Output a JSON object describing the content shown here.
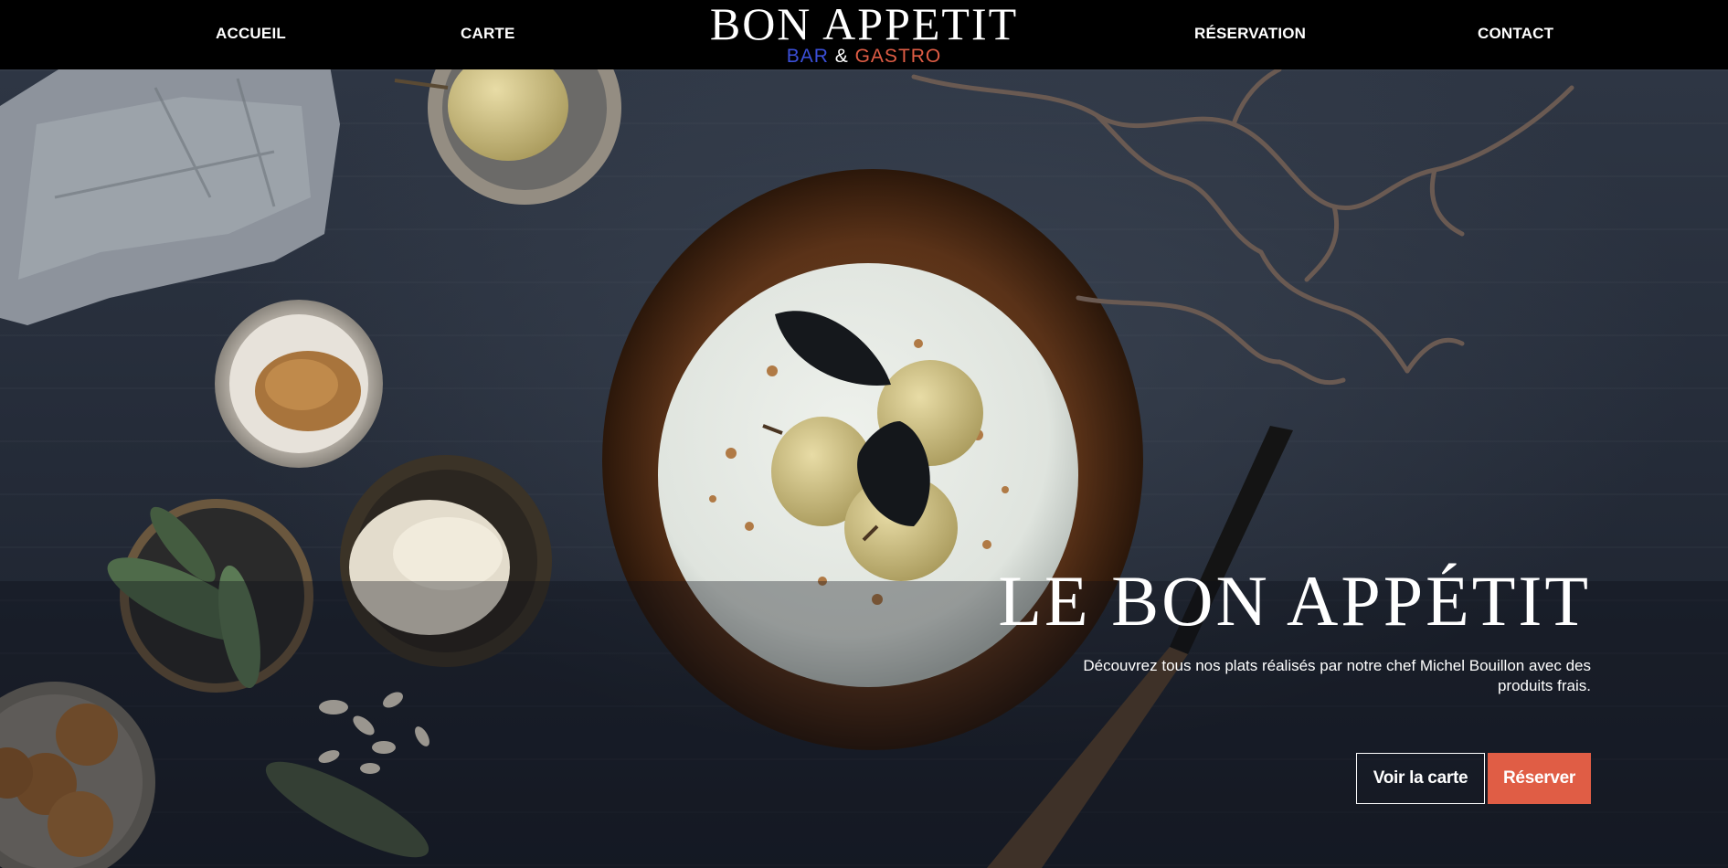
{
  "header": {
    "nav_left": [
      "ACCUEIL",
      "CARTE"
    ],
    "nav_right": [
      "RÉSERVATION",
      "CONTACT"
    ],
    "logo": {
      "title": "BON APPETIT",
      "sub_bar": "BAR",
      "sub_amp": "&",
      "sub_gastro": "GASTRO"
    }
  },
  "hero": {
    "title": "LE BON APPÉTIT",
    "description": "Découvrez tous nos plats réalisés par notre chef Michel Bouillon avec des produits frais.",
    "btn_menu": "Voir la carte",
    "btn_reserve": "Réserver"
  },
  "colors": {
    "header_bg": "#000000",
    "sub_bar": "#3b4fd8",
    "sub_gastro": "#e05d45",
    "reserve_button": "#e05d45"
  }
}
